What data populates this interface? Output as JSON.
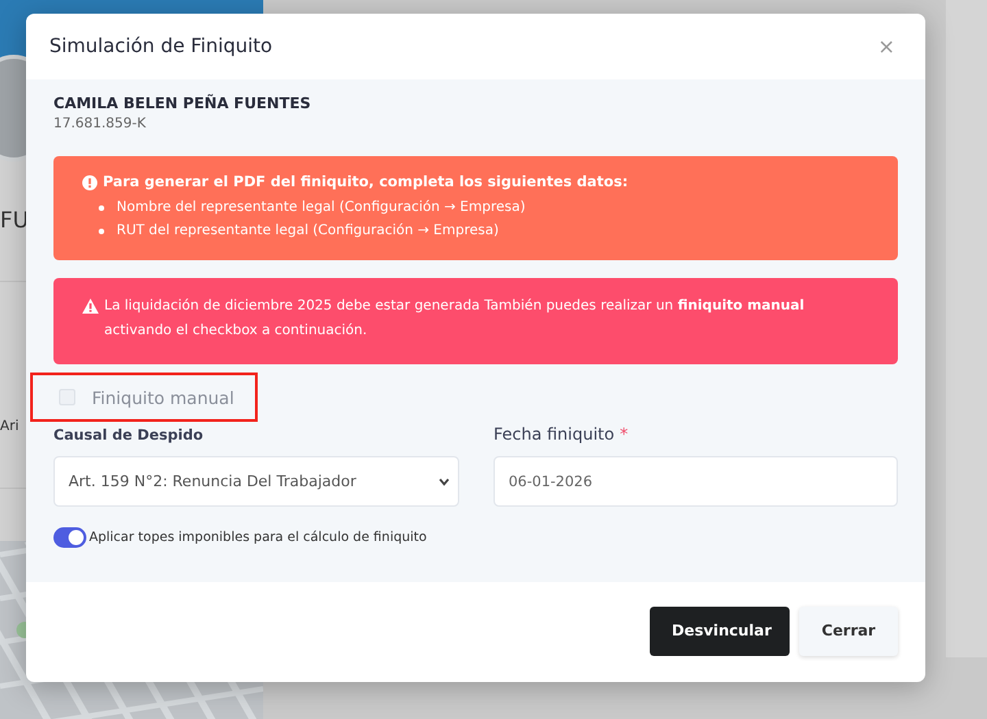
{
  "background": {
    "texts": [
      {
        "kind": "heading",
        "text": "FU"
      },
      {
        "kind": "address",
        "text": "Ari"
      }
    ]
  },
  "modal": {
    "title": "Simulación de Finiquito",
    "close": "×",
    "employee": {
      "name": "CAMILA BELEN PEÑA FUENTES",
      "rut": "17.681.859-K"
    },
    "alerts": [
      {
        "kind": "warning",
        "color": "#ff7058",
        "title": "Para generar el PDF del finiquito, completa los siguientes datos:",
        "items": [
          "Nombre del representante legal (Configuración → Empresa)",
          "RUT del representante legal (Configuración → Empresa)"
        ]
      },
      {
        "kind": "danger",
        "color": "#fd4d6c",
        "text": "La liquidación de diciembre 2025 debe estar generada También puedes realizar un **finiquito manual** activando el checkbox a continuación."
      }
    ],
    "manual_checkbox": {
      "label": "Finiquito manual",
      "checked": false,
      "disabled": true,
      "highlighted": true
    },
    "cause": {
      "label": "Causal de Despido",
      "value": "Art. 159 N°2: Renuncia Del Trabajador"
    },
    "date": {
      "label": "Fecha finiquito",
      "required": "*",
      "value": "06-01-2026"
    },
    "toggle": {
      "label": "Aplicar topes imponibles para el cálculo de finiquito",
      "on": true
    },
    "buttons": [
      {
        "kind": "primary",
        "label": "Desvincular"
      },
      {
        "kind": "secondary",
        "label": "Cerrar"
      }
    ]
  }
}
